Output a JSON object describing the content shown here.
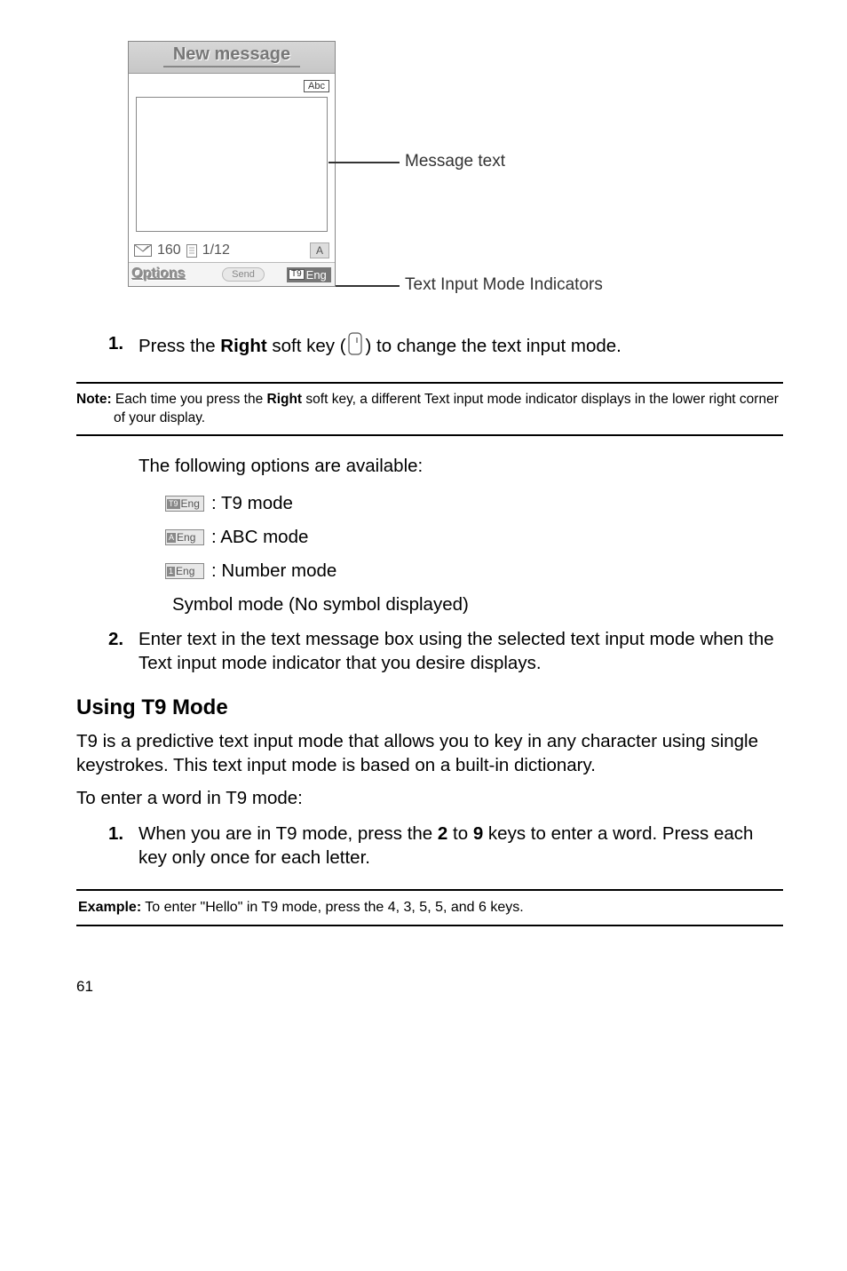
{
  "phone": {
    "title": "New message",
    "mode_badge": "Abc",
    "char_count": "160",
    "page_indicator": "1/12",
    "a_badge": "A",
    "softkey_left": "Options",
    "softkey_center": "Send",
    "softkey_right_label": "Eng",
    "t9_square": "T9"
  },
  "callouts": {
    "message_text": "Message text",
    "indicators": "Text Input Mode Indicators"
  },
  "steps": {
    "s1_num": "1.",
    "s1_a": "Press the ",
    "s1_b": "Right",
    "s1_c": " soft key (",
    "s1_d": ") to change the text input mode.",
    "s2_num": "2.",
    "s2_text": "Enter text in the text message box using the selected text input mode when the Text input mode indicator that you desire displays.",
    "t9_1_num": "1.",
    "t9_1_a": "When you are in T9 mode, press the ",
    "t9_1_b": "2",
    "t9_1_c": " to ",
    "t9_1_d": "9",
    "t9_1_e": " keys to enter a word. Press each key only once for each letter."
  },
  "note": {
    "label": "Note:",
    "before_bold": " Each time you press the ",
    "bold": "Right",
    "after_bold": " soft key, a different Text input mode indicator displays in the lower right corner of your display."
  },
  "subtext": "The following options are available:",
  "modes": {
    "t9_sq": "T9",
    "t9_txt": "Eng",
    "t9_desc": ": T9 mode",
    "abc_sq": "A",
    "abc_txt": "Eng",
    "abc_desc": ": ABC mode",
    "num_sq": "1",
    "num_txt": "Eng",
    "num_desc": ": Number mode",
    "sym_desc": "Symbol mode (No symbol displayed)"
  },
  "t9_section": {
    "heading": "Using T9 Mode",
    "para1": "T9 is a predictive text input mode that allows you to key in any character using single keystrokes. This text input mode is based on a built-in dictionary.",
    "para2": "To enter a word in T9 mode:"
  },
  "example": {
    "label": "Example:",
    "text": " To enter \"Hello\" in T9 mode, press the 4, 3, 5, 5, and 6 keys."
  },
  "page_num": "61"
}
